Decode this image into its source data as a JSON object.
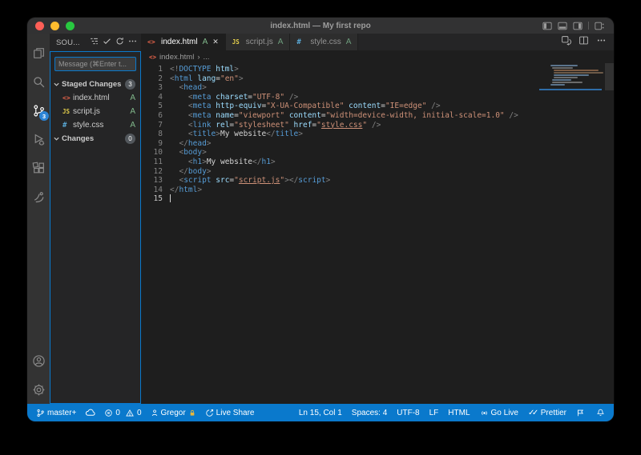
{
  "window": {
    "title": "index.html — My first repo"
  },
  "activity_bar": {
    "scm_badge": "3"
  },
  "icons": {
    "html": "<>",
    "js": "JS",
    "css": "#",
    "close": "✕",
    "more": "⋯",
    "chevron_right": "›"
  },
  "sidebar": {
    "title": "SOU...",
    "message_placeholder": "Message (⌘Enter t...",
    "staged": {
      "label": "Staged Changes",
      "badge": "3"
    },
    "changes": {
      "label": "Changes",
      "badge": "0"
    },
    "files": [
      {
        "name": "index.html",
        "icon": "html",
        "status": "A"
      },
      {
        "name": "script.js",
        "icon": "js",
        "status": "A"
      },
      {
        "name": "style.css",
        "icon": "css",
        "status": "A"
      }
    ]
  },
  "tabs": [
    {
      "label": "index.html",
      "status": "A",
      "active": true
    },
    {
      "label": "script.js",
      "status": "A",
      "active": false
    },
    {
      "label": "style.css",
      "status": "A",
      "active": false
    }
  ],
  "breadcrumb": {
    "file": "index.html",
    "more": "..."
  },
  "editor": {
    "lines": [
      {
        "n": 1,
        "tokens": [
          [
            "p",
            "<!"
          ],
          [
            "tag",
            "DOCTYPE"
          ],
          [
            "txt",
            " "
          ],
          [
            "attr",
            "html"
          ],
          [
            "p",
            ">"
          ]
        ]
      },
      {
        "n": 2,
        "tokens": [
          [
            "p",
            "<"
          ],
          [
            "tag",
            "html"
          ],
          [
            "txt",
            " "
          ],
          [
            "attr",
            "lang"
          ],
          [
            "o",
            "="
          ],
          [
            "str",
            "\"en\""
          ],
          [
            "p",
            ">"
          ]
        ]
      },
      {
        "n": 3,
        "tokens": [
          [
            "txt",
            "  "
          ],
          [
            "p",
            "<"
          ],
          [
            "tag",
            "head"
          ],
          [
            "p",
            ">"
          ]
        ]
      },
      {
        "n": 4,
        "tokens": [
          [
            "txt",
            "    "
          ],
          [
            "p",
            "<"
          ],
          [
            "tag",
            "meta"
          ],
          [
            "txt",
            " "
          ],
          [
            "attr",
            "charset"
          ],
          [
            "o",
            "="
          ],
          [
            "str",
            "\"UTF-8\""
          ],
          [
            "txt",
            " "
          ],
          [
            "p",
            "/>"
          ]
        ]
      },
      {
        "n": 5,
        "tokens": [
          [
            "txt",
            "    "
          ],
          [
            "p",
            "<"
          ],
          [
            "tag",
            "meta"
          ],
          [
            "txt",
            " "
          ],
          [
            "attr",
            "http-equiv"
          ],
          [
            "o",
            "="
          ],
          [
            "str",
            "\"X-UA-Compatible\""
          ],
          [
            "txt",
            " "
          ],
          [
            "attr",
            "content"
          ],
          [
            "o",
            "="
          ],
          [
            "str",
            "\"IE=edge\""
          ],
          [
            "txt",
            " "
          ],
          [
            "p",
            "/>"
          ]
        ]
      },
      {
        "n": 6,
        "tokens": [
          [
            "txt",
            "    "
          ],
          [
            "p",
            "<"
          ],
          [
            "tag",
            "meta"
          ],
          [
            "txt",
            " "
          ],
          [
            "attr",
            "name"
          ],
          [
            "o",
            "="
          ],
          [
            "str",
            "\"viewport\""
          ],
          [
            "txt",
            " "
          ],
          [
            "attr",
            "content"
          ],
          [
            "o",
            "="
          ],
          [
            "str",
            "\"width=device-width, initial-scale=1.0\""
          ],
          [
            "txt",
            " "
          ],
          [
            "p",
            "/>"
          ]
        ]
      },
      {
        "n": 7,
        "tokens": [
          [
            "txt",
            "    "
          ],
          [
            "p",
            "<"
          ],
          [
            "tag",
            "link"
          ],
          [
            "txt",
            " "
          ],
          [
            "attr",
            "rel"
          ],
          [
            "o",
            "="
          ],
          [
            "str",
            "\"stylesheet\""
          ],
          [
            "txt",
            " "
          ],
          [
            "attr",
            "href"
          ],
          [
            "o",
            "="
          ],
          [
            "str",
            "\""
          ],
          [
            "lnk",
            "style.css"
          ],
          [
            "str",
            "\""
          ],
          [
            "txt",
            " "
          ],
          [
            "p",
            "/>"
          ]
        ]
      },
      {
        "n": 8,
        "tokens": [
          [
            "txt",
            "    "
          ],
          [
            "p",
            "<"
          ],
          [
            "tag",
            "title"
          ],
          [
            "p",
            ">"
          ],
          [
            "txt",
            "My website"
          ],
          [
            "p",
            "</"
          ],
          [
            "tag",
            "title"
          ],
          [
            "p",
            ">"
          ]
        ]
      },
      {
        "n": 9,
        "tokens": [
          [
            "txt",
            "  "
          ],
          [
            "p",
            "</"
          ],
          [
            "tag",
            "head"
          ],
          [
            "p",
            ">"
          ]
        ]
      },
      {
        "n": 10,
        "tokens": [
          [
            "txt",
            "  "
          ],
          [
            "p",
            "<"
          ],
          [
            "tag",
            "body"
          ],
          [
            "p",
            ">"
          ]
        ]
      },
      {
        "n": 11,
        "tokens": [
          [
            "txt",
            "    "
          ],
          [
            "p",
            "<"
          ],
          [
            "tag",
            "h1"
          ],
          [
            "p",
            ">"
          ],
          [
            "txt",
            "My website"
          ],
          [
            "p",
            "</"
          ],
          [
            "tag",
            "h1"
          ],
          [
            "p",
            ">"
          ]
        ]
      },
      {
        "n": 12,
        "tokens": [
          [
            "txt",
            "  "
          ],
          [
            "p",
            "</"
          ],
          [
            "tag",
            "body"
          ],
          [
            "p",
            ">"
          ]
        ]
      },
      {
        "n": 13,
        "tokens": [
          [
            "txt",
            "  "
          ],
          [
            "p",
            "<"
          ],
          [
            "tag",
            "script"
          ],
          [
            "txt",
            " "
          ],
          [
            "attr",
            "src"
          ],
          [
            "o",
            "="
          ],
          [
            "str",
            "\""
          ],
          [
            "lnk",
            "script.js"
          ],
          [
            "str",
            "\""
          ],
          [
            "p",
            ">"
          ],
          [
            "p",
            "</"
          ],
          [
            "tag",
            "script"
          ],
          [
            "p",
            ">"
          ]
        ]
      },
      {
        "n": 14,
        "tokens": [
          [
            "p",
            "</"
          ],
          [
            "tag",
            "html"
          ],
          [
            "p",
            ">"
          ]
        ]
      },
      {
        "n": 15,
        "tokens": [],
        "active": true,
        "cursor": true
      }
    ]
  },
  "status_bar": {
    "branch": "master+",
    "errors": "0",
    "warnings": "0",
    "user": "Gregor",
    "live_share": "Live Share",
    "line_col": "Ln 15, Col 1",
    "spaces": "Spaces: 4",
    "encoding": "UTF-8",
    "eol": "LF",
    "language": "HTML",
    "go_live": "Go Live",
    "prettier": "Prettier"
  }
}
